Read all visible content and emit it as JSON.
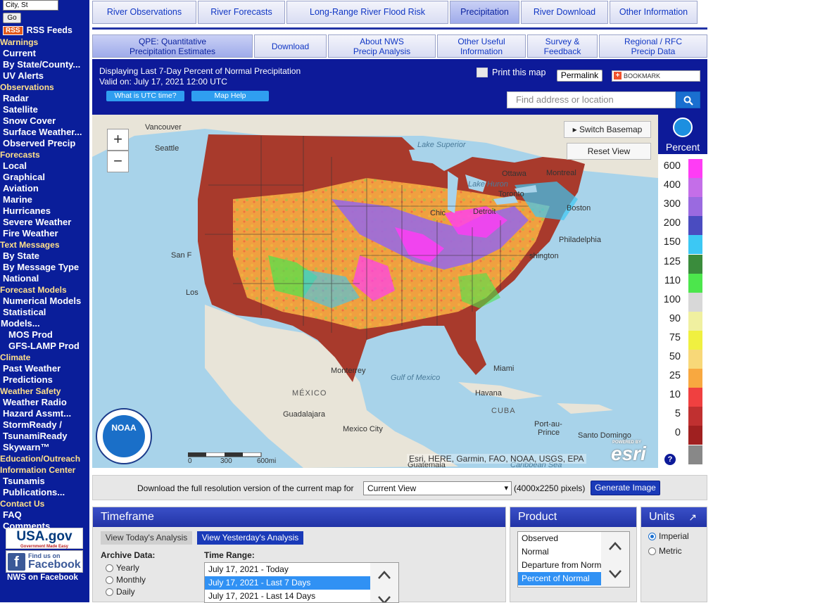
{
  "nav": {
    "search_placeholder": "City, St",
    "go_label": "Go",
    "rss_badge": "RSS",
    "rss_label": "RSS Feeds",
    "sections": [
      {
        "head": "Warnings",
        "items": [
          "Current",
          "By State/County...",
          "UV Alerts"
        ]
      },
      {
        "head": "Observations",
        "items": [
          "Radar",
          "Satellite",
          "Snow Cover",
          "Surface Weather...",
          "Observed Precip"
        ]
      },
      {
        "head": "Forecasts",
        "items": [
          "Local",
          "Graphical",
          "Aviation",
          "Marine",
          "Hurricanes",
          "Severe Weather",
          "Fire Weather"
        ]
      },
      {
        "head": "Text Messages",
        "items": [
          "By State",
          "By Message Type",
          "National"
        ]
      },
      {
        "head": "Forecast Models",
        "items": [
          "Numerical Models",
          "Statistical"
        ]
      }
    ],
    "models_tail": "Models...",
    "models_sub": [
      "MOS Prod",
      "GFS-LAMP Prod"
    ],
    "sections2": [
      {
        "head": "Climate",
        "items": [
          "Past Weather",
          "Predictions"
        ]
      },
      {
        "head": "Weather Safety",
        "items": [
          "Weather Radio",
          "Hazard Assmt...",
          "StormReady /",
          "TsunamiReady",
          "Skywarn™"
        ]
      }
    ],
    "edu_head": "Education/Outreach",
    "info_head": "Information Center",
    "info_items": [
      "Tsunamis",
      "Publications..."
    ],
    "contact_head": "Contact Us",
    "contact_items": [
      "FAQ",
      "Comments..."
    ],
    "usagov": "USA.gov",
    "usagov_tag": "Government Made Easy",
    "fb_small": "Find us on",
    "fb_big": "Facebook",
    "nws_fb": "NWS on Facebook"
  },
  "tabs": {
    "row1": [
      "River Observations",
      "River Forecasts",
      "Long-Range River Flood Risk",
      "Precipitation",
      "River Download",
      "Other Information"
    ],
    "row1_active": 3,
    "row2": [
      {
        "l1": "QPE: Quantitative",
        "l2": "Precipitation Estimates"
      },
      {
        "l1": "Download",
        "l2": ""
      },
      {
        "l1": "About NWS",
        "l2": "Precip Analysis"
      },
      {
        "l1": "Other Useful",
        "l2": "Information"
      },
      {
        "l1": "Survey &",
        "l2": "Feedback"
      },
      {
        "l1": "Regional / RFC",
        "l2": "Precip Data"
      }
    ]
  },
  "info": {
    "display_line": "Displaying Last 7-Day Percent of Normal Precipitation",
    "valid_line": "Valid on: July 17, 2021 12:00 UTC",
    "utc_btn": "What is UTC time?",
    "help_btn": "Map Help",
    "print_label": "Print this map",
    "permalink": "Permalink",
    "bookmark": "BOOKMARK",
    "find_placeholder": "Find address or location"
  },
  "map": {
    "switch_basemap": "Switch Basemap",
    "reset_view": "Reset View",
    "zoom_in": "+",
    "zoom_out": "−",
    "labels": [
      "Vancouver",
      "Seattle",
      "Ottawa",
      "Montreal",
      "Toronto",
      "Boston",
      "Detroit",
      "Chic",
      "Philadelphia",
      "shington",
      "San F",
      "Los",
      "Miami",
      "Havana",
      "CUBA",
      "Port-au-",
      "Prince",
      "Santo Domingo",
      "Monterrey",
      "MÉXICO",
      "Guadalajara",
      "Mexico City",
      "Guatemala",
      "Caribbean Sea",
      "Lake Superior",
      "Lake Huron",
      "Gulf of Mexico",
      "Lake"
    ],
    "scale_labels": [
      "0",
      "300",
      "600mi"
    ],
    "attribution": "Esri, HERE, Garmin, FAO, NOAA, USGS, EPA",
    "esri_powered": "POWERED BY",
    "esri": "esri",
    "noaa": "NOAA"
  },
  "legend": {
    "title": "Percent",
    "values": [
      "600",
      "400",
      "300",
      "200",
      "150",
      "125",
      "110",
      "100",
      "90",
      "75",
      "50",
      "25",
      "10",
      "5",
      "0"
    ],
    "colors": [
      "#ff3cf5",
      "#c46ee8",
      "#9a6ae0",
      "#4a4cc0",
      "#3cc8f4",
      "#3a8c3c",
      "#4ce64c",
      "#d8d8d8",
      "#f0f0a0",
      "#f0f040",
      "#f8d878",
      "#f8a840",
      "#f04040",
      "#c03030",
      "#a02020",
      "#888888"
    ]
  },
  "download": {
    "text": "Download the full resolution version of the current map for",
    "select_value": "Current View",
    "text2": "(4000x2250 pixels)",
    "button": "Generate Image"
  },
  "timeframe": {
    "title": "Timeframe",
    "today_btn": "View Today's Analysis",
    "yesterday_btn": "View Yesterday's Analysis",
    "archive_label": "Archive Data:",
    "archive_options": [
      "Yearly",
      "Monthly",
      "Daily"
    ],
    "range_label": "Time Range:",
    "ranges": [
      "July 17, 2021 - Today",
      "July 17, 2021 - Last 7 Days",
      "July 17, 2021 - Last 14 Days"
    ],
    "selected_range": 1
  },
  "product": {
    "title": "Product",
    "options": [
      "Observed",
      "Normal",
      "Departure from Norm",
      "Percent of Normal"
    ],
    "selected": 3
  },
  "units": {
    "title": "Units",
    "options": [
      "Imperial",
      "Metric"
    ],
    "selected": 0
  }
}
